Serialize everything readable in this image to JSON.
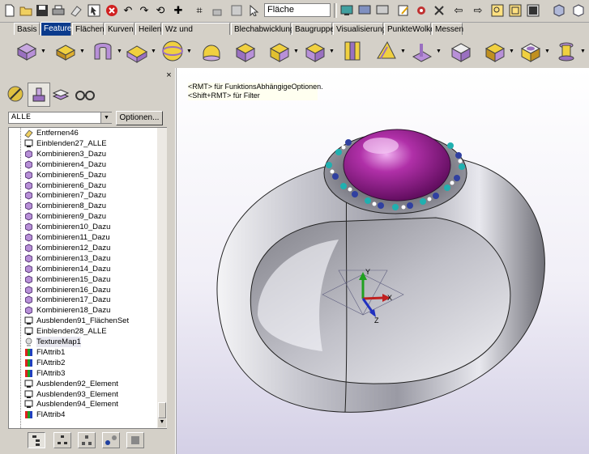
{
  "toolbar": {
    "flaeche_value": "Fläche",
    "icons": [
      "new-file-icon",
      "open-folder-icon",
      "save-icon",
      "print-icon",
      "eraser-icon",
      "help-cursor-icon",
      "cancel-icon",
      "undo-icon",
      "redo-icon",
      "rotate-view-icon",
      "snap-icon",
      "select-icon",
      "cursor-icon",
      "monitor-icon",
      "layers-icon",
      "edit-icon",
      "tools-icon",
      "close-x-icon",
      "back-arrow-icon",
      "forward-arrow-icon",
      "zoom-icon",
      "zoom-window-icon",
      "fit-icon",
      "cube-icon"
    ]
  },
  "tabs": [
    {
      "label": "Basis",
      "active": false
    },
    {
      "label": "Feature",
      "active": true
    },
    {
      "label": "Flächen",
      "active": false
    },
    {
      "label": "Kurven",
      "active": false
    },
    {
      "label": "Heilen",
      "active": false
    },
    {
      "label": "Wz und Formenbau",
      "active": false
    },
    {
      "label": "Blechabwicklung",
      "active": false
    },
    {
      "label": "Baugruppe",
      "active": false
    },
    {
      "label": "Visualisierung",
      "active": false
    },
    {
      "label": "PunkteWolke",
      "active": false
    },
    {
      "label": "Messen",
      "active": false
    }
  ],
  "panel": {
    "filter_value": "ALLE",
    "options_label": "Optionen...",
    "close_label": "×"
  },
  "tree_items": [
    {
      "label": "Entfernen46",
      "icon": "eraser"
    },
    {
      "label": "Einblenden27_ALLE",
      "icon": "monitor"
    },
    {
      "label": "Kombinieren3_Dazu",
      "icon": "cube"
    },
    {
      "label": "Kombinieren4_Dazu",
      "icon": "cube"
    },
    {
      "label": "Kombinieren5_Dazu",
      "icon": "cube"
    },
    {
      "label": "Kombinieren6_Dazu",
      "icon": "cube"
    },
    {
      "label": "Kombinieren7_Dazu",
      "icon": "cube"
    },
    {
      "label": "Kombinieren8_Dazu",
      "icon": "cube"
    },
    {
      "label": "Kombinieren9_Dazu",
      "icon": "cube"
    },
    {
      "label": "Kombinieren10_Dazu",
      "icon": "cube"
    },
    {
      "label": "Kombinieren11_Dazu",
      "icon": "cube"
    },
    {
      "label": "Kombinieren12_Dazu",
      "icon": "cube"
    },
    {
      "label": "Kombinieren13_Dazu",
      "icon": "cube"
    },
    {
      "label": "Kombinieren14_Dazu",
      "icon": "cube"
    },
    {
      "label": "Kombinieren15_Dazu",
      "icon": "cube"
    },
    {
      "label": "Kombinieren16_Dazu",
      "icon": "cube"
    },
    {
      "label": "Kombinieren17_Dazu",
      "icon": "cube"
    },
    {
      "label": "Kombinieren18_Dazu",
      "icon": "cube"
    },
    {
      "label": "Ausblenden91_FlächenSet",
      "icon": "monitor"
    },
    {
      "label": "Einblenden28_ALLE",
      "icon": "monitor"
    },
    {
      "label": "TextureMap1",
      "icon": "texture",
      "selected": true
    },
    {
      "label": "FlAttrib1",
      "icon": "attrib"
    },
    {
      "label": "FlAttrib2",
      "icon": "attrib"
    },
    {
      "label": "FlAttrib3",
      "icon": "attrib"
    },
    {
      "label": "Ausblenden92_Element",
      "icon": "monitor"
    },
    {
      "label": "Ausblenden93_Element",
      "icon": "monitor"
    },
    {
      "label": "Ausblenden94_Element",
      "icon": "monitor"
    },
    {
      "label": "FlAttrib4",
      "icon": "attrib"
    }
  ],
  "viewport": {
    "hint_line1": "<RMT> für FunktionsAbhängigeOptionen.",
    "hint_line2": "<Shift+RMT> für Filter",
    "axis_x": "X",
    "axis_y": "Y",
    "axis_z": "Z",
    "bg_axis_y": "Y"
  },
  "colors": {
    "active_tab": "#0a3a8c",
    "gem": "#9a1a8a",
    "ring": "#b8b8c0"
  }
}
